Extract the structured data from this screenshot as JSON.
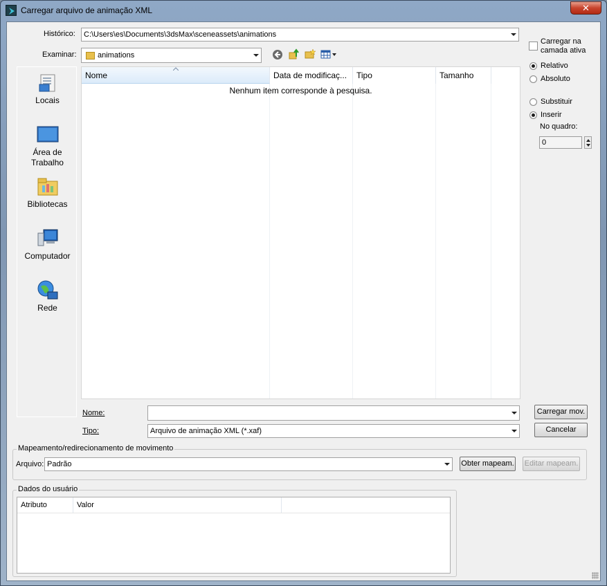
{
  "window": {
    "title": "Carregar arquivo de animação XML",
    "close_glyph": "✕"
  },
  "history": {
    "label": "Histórico:",
    "value": "C:\\Users\\es\\Documents\\3dsMax\\sceneassets\\animations"
  },
  "lookin": {
    "label": "Examinar:",
    "value": "animations"
  },
  "toolbar": {
    "icons": [
      "back-icon",
      "up-folder-icon",
      "new-folder-icon",
      "view-menu-icon"
    ]
  },
  "places": [
    {
      "label": "Locais",
      "icon": "recent-places-icon"
    },
    {
      "label": "Área de Trabalho",
      "icon": "desktop-icon"
    },
    {
      "label": "Bibliotecas",
      "icon": "libraries-icon"
    },
    {
      "label": "Computador",
      "icon": "computer-icon"
    },
    {
      "label": "Rede",
      "icon": "network-icon"
    }
  ],
  "filelist": {
    "columns": [
      "Nome",
      "Data de modificaç...",
      "Tipo",
      "Tamanho"
    ],
    "empty_message": "Nenhum item corresponde à pesquisa."
  },
  "filename": {
    "label": "Nome:",
    "value": ""
  },
  "filetype": {
    "label": "Tipo:",
    "value": "Arquivo de animação XML (*.xaf)"
  },
  "buttons": {
    "load": "Carregar mov.",
    "cancel": "Cancelar"
  },
  "options": {
    "active_layer": "Carregar na camada ativa",
    "relative": "Relativo",
    "absolute": "Absoluto",
    "replace": "Substituir",
    "insert": "Inserir",
    "at_frame_label": "No quadro:",
    "at_frame_value": "0"
  },
  "mapping": {
    "title": "Mapeamento/redirecionamento de movimento",
    "file_label": "Arquivo:",
    "file_value": "Padrão",
    "get_map": "Obter mapeam.",
    "edit_map": "Editar mapeam."
  },
  "userdata": {
    "title": "Dados do usuário",
    "columns": [
      "Atributo",
      "Valor"
    ]
  }
}
